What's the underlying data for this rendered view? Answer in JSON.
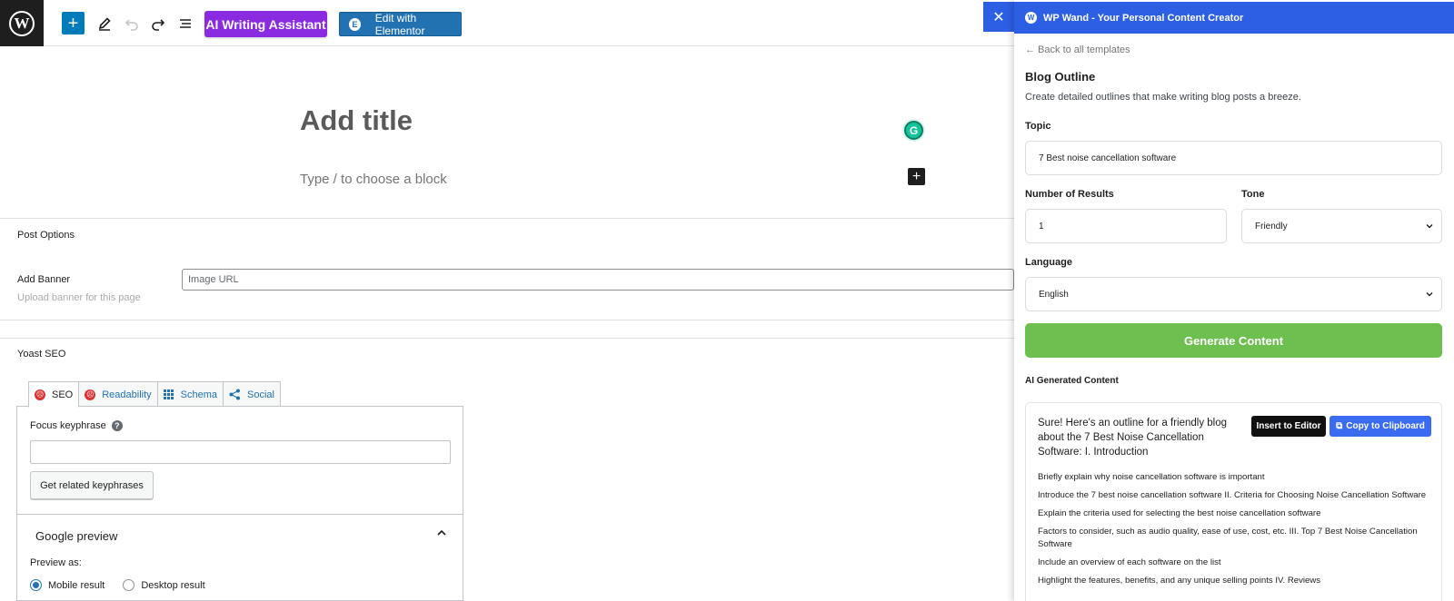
{
  "colors": {
    "wp_blue": "#007cba",
    "ai_purple": "#8a2be2",
    "elementor_blue": "#2271b1",
    "panel_header": "#2c5fe3",
    "generate_green": "#6dc04f",
    "copy_blue": "#3b6bf0",
    "yoast_bad": "#dc3232"
  },
  "toolbar": {
    "logo_glyph": "W",
    "add_glyph": "+",
    "ai_writing_label": "AI Writing Assistant",
    "elementor_label": "Edit with Elementor",
    "elementor_glyph": "E",
    "icons": [
      "wordpress-logo-icon",
      "add-block-icon",
      "pencil-icon",
      "undo-icon",
      "redo-icon",
      "list-view-icon"
    ]
  },
  "editor": {
    "title_placeholder": "Add title",
    "block_placeholder": "Type / to choose a block",
    "grammarly_glyph": "G",
    "block_add_glyph": "+"
  },
  "post_options": {
    "section_title": "Post Options",
    "add_banner_label": "Add Banner",
    "add_banner_help": "Upload banner for this page",
    "image_url_placeholder": "Image URL"
  },
  "yoast": {
    "section_title": "Yoast SEO",
    "tabs": [
      {
        "label": "SEO",
        "icon": "sad-face-icon",
        "active": true
      },
      {
        "label": "Readability",
        "icon": "sad-face-icon",
        "active": false
      },
      {
        "label": "Schema",
        "icon": "grid-icon",
        "active": false
      },
      {
        "label": "Social",
        "icon": "share-icon",
        "active": false
      }
    ],
    "sad_glyph": "☹",
    "focus_keyphrase_label": "Focus keyphrase",
    "help_glyph": "?",
    "focus_keyphrase_value": "",
    "related_button": "Get related keyphrases",
    "google_preview_title": "Google preview",
    "preview_as_label": "Preview as:",
    "preview_options": [
      {
        "label": "Mobile result",
        "selected": true
      },
      {
        "label": "Desktop result",
        "selected": false
      }
    ]
  },
  "wpwand": {
    "close_glyph": "✕",
    "logo_glyph": "W",
    "header_title": "WP Wand - Your Personal Content Creator",
    "back_link": "← Back to all templates",
    "template_title": "Blog Outline",
    "template_desc": "Create detailed outlines that make writing blog posts a breeze.",
    "topic_label": "Topic",
    "topic_value": "7 Best noise cancellation software",
    "results_label": "Number of Results",
    "results_value": "1",
    "tone_label": "Tone",
    "tone_value": "Friendly",
    "language_label": "Language",
    "language_value": "English",
    "generate_button": "Generate Content",
    "output_label": "AI Generated Content",
    "output_intro": "Sure! Here's an outline for a friendly blog about the 7 Best Noise Cancellation Software: I. Introduction",
    "insert_button": "Insert to Editor",
    "copy_button": "Copy to Clipboard",
    "copy_glyph": "⧉",
    "output_lines": [
      "Briefly explain why noise cancellation software is important",
      "Introduce the 7 best noise cancellation software II. Criteria for Choosing Noise Cancellation Software",
      "Explain the criteria used for selecting the best noise cancellation software",
      "Factors to consider, such as audio quality, ease of use, cost, etc. III. Top 7 Best Noise Cancellation Software",
      "Include an overview of each software on the list",
      "Highlight the features, benefits, and any unique selling points IV. Reviews"
    ]
  }
}
